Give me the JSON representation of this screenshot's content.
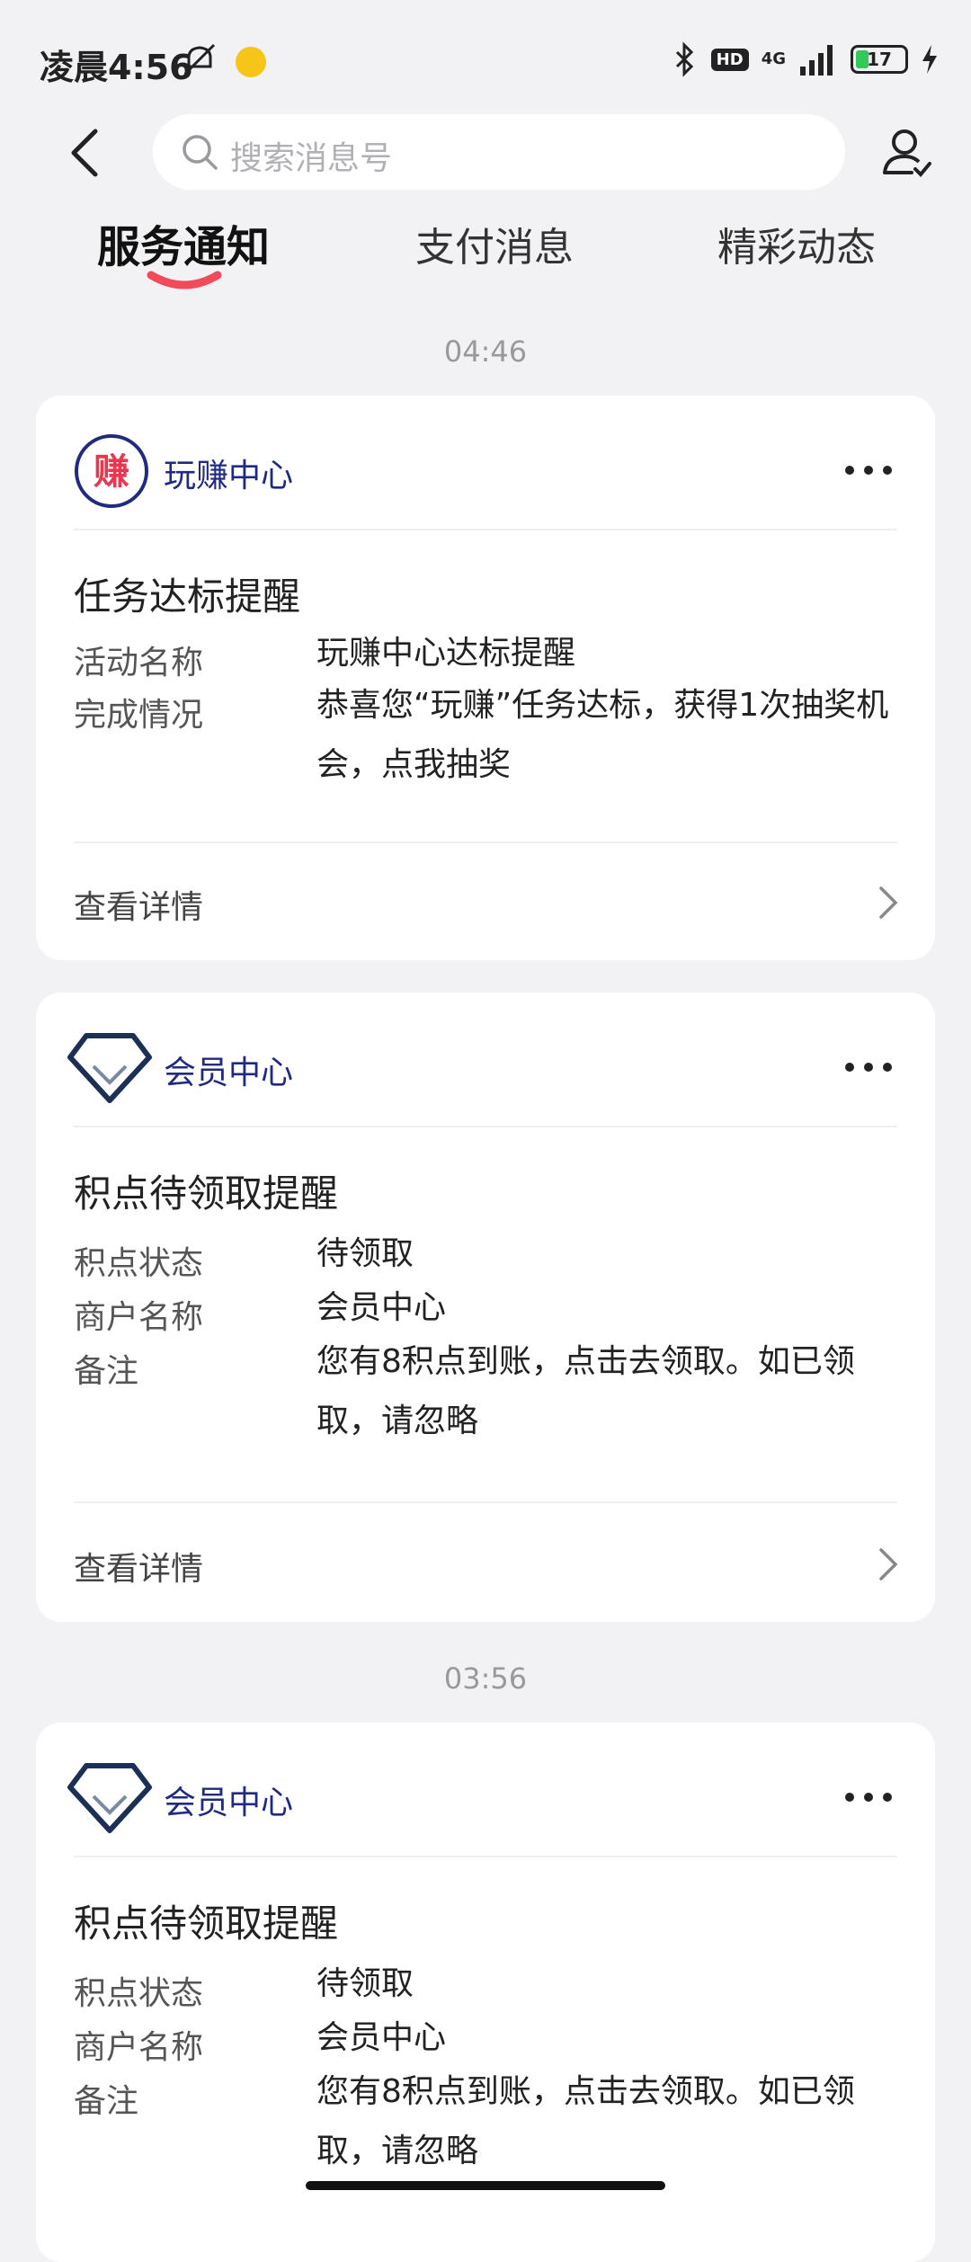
{
  "status": {
    "time": "凌晨4:56",
    "hd": "HD",
    "net": "4G",
    "battery": "17"
  },
  "search": {
    "placeholder": "搜索消息号"
  },
  "tabs": [
    {
      "label": "服务通知",
      "active": true
    },
    {
      "label": "支付消息",
      "active": false
    },
    {
      "label": "精彩动态",
      "active": false
    }
  ],
  "colors": {
    "accent_underline": "#f24a5a",
    "source_name": "#1f2a80",
    "earn_logo_red": "#e8384f"
  },
  "groups": [
    {
      "time": "04:46",
      "card": {
        "source": "玩赚中心",
        "logo_char": "赚",
        "title": "任务达标提醒",
        "rows": [
          {
            "key": "活动名称",
            "value": "玩赚中心达标提醒"
          },
          {
            "key": "完成情况",
            "value": "恭喜您“玩赚”任务达标，获得1次抽奖机会，点我抽奖"
          }
        ],
        "detail": "查看详情"
      }
    },
    {
      "time": "",
      "card": {
        "source": "会员中心",
        "title": "积点待领取提醒",
        "rows": [
          {
            "key": "积点状态",
            "value": "待领取"
          },
          {
            "key": "商户名称",
            "value": "会员中心"
          },
          {
            "key": "备注",
            "value": "您有8积点到账，点击去领取。如已领取，请忽略"
          }
        ],
        "detail": "查看详情"
      }
    },
    {
      "time": "03:56",
      "card": {
        "source": "会员中心",
        "title": "积点待领取提醒",
        "rows": [
          {
            "key": "积点状态",
            "value": "待领取"
          },
          {
            "key": "商户名称",
            "value": "会员中心"
          },
          {
            "key": "备注",
            "value": "您有8积点到账，点击去领取。如已领取，请忽略"
          }
        ]
      }
    }
  ]
}
